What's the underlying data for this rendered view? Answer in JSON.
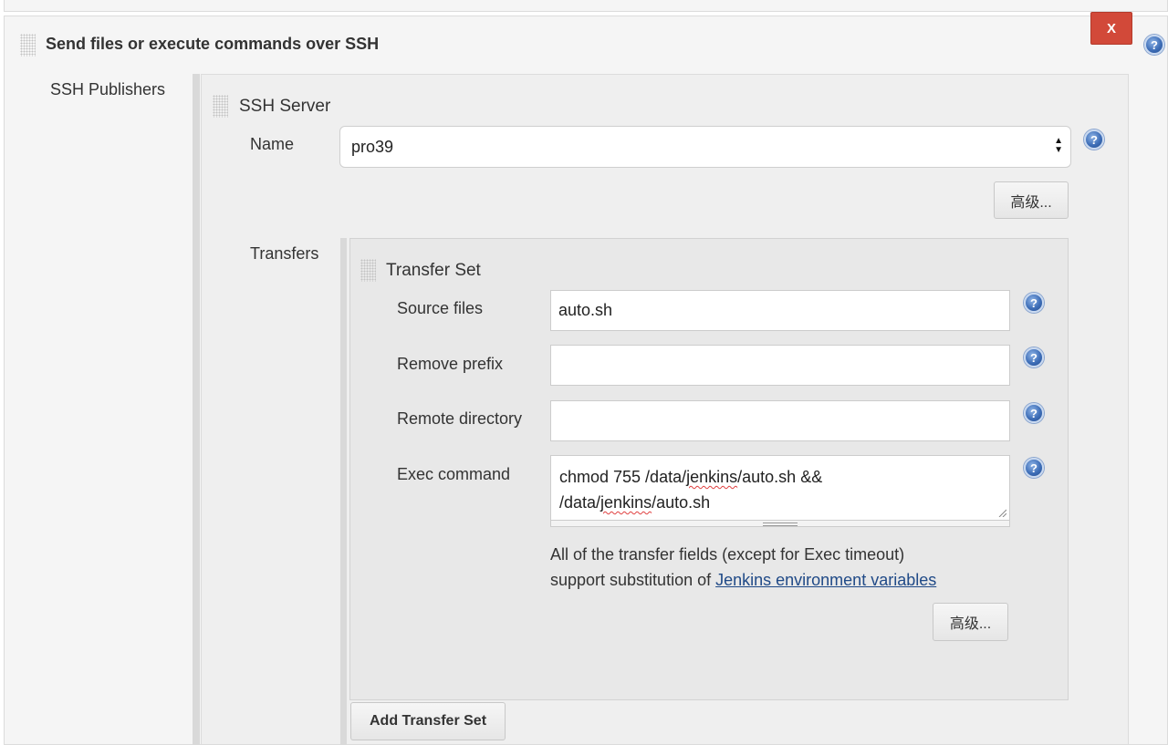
{
  "section": {
    "title": "Send files or execute commands over SSH",
    "delete_label": "X"
  },
  "publishers": {
    "label": "SSH Publishers",
    "server": {
      "title": "SSH Server",
      "name_label": "Name",
      "name_value": "pro39",
      "advanced_label": "高级...",
      "transfers_label": "Transfers",
      "transfer_set": {
        "title": "Transfer Set",
        "source_files_label": "Source files",
        "source_files_value": "auto.sh",
        "remove_prefix_label": "Remove prefix",
        "remove_prefix_value": "",
        "remote_directory_label": "Remote directory",
        "remote_directory_value": "",
        "exec_command_label": "Exec command",
        "exec_command_line1_a": "chmod 755 /data/",
        "exec_command_line1_b": "jenkins",
        "exec_command_line1_c": "/auto.sh &&",
        "exec_command_line2_a": "/data/",
        "exec_command_line2_b": "jenkins",
        "exec_command_line2_c": "/auto.sh",
        "note_line1": "All of the transfer fields (except for Exec timeout)",
        "note_line2_prefix": "support substitution of ",
        "note_link": "Jenkins environment variables",
        "advanced_label": "高级..."
      },
      "add_transfer_set_label": "Add Transfer Set"
    }
  },
  "icons": {
    "help": "help-icon",
    "help_glyph": "?",
    "grip": "drag-handle-icon",
    "delete": "close-icon"
  },
  "colors": {
    "delete_button": "#d24939",
    "link": "#204a87",
    "help_icon": "#3f6fb8"
  }
}
